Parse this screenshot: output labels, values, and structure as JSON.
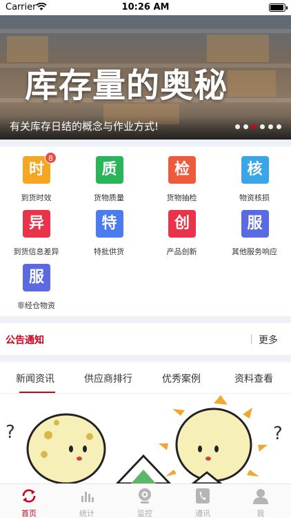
{
  "status_bar": {
    "carrier": "Carrier",
    "time": "10:26 AM"
  },
  "banner": {
    "headline": "库存量的奥秘",
    "caption": "有关库存日结的概念与作业方式!",
    "page_count": 6,
    "active_page": 3
  },
  "grid": [
    {
      "glyph": "时",
      "label": "到货时效",
      "color": "#f5a623",
      "badge": "8"
    },
    {
      "glyph": "质",
      "label": "货物质量",
      "color": "#2ab55a"
    },
    {
      "glyph": "检",
      "label": "货物抽检",
      "color": "#ee5a3c"
    },
    {
      "glyph": "核",
      "label": "物资核损",
      "color": "#3aa6e8"
    },
    {
      "glyph": "异",
      "label": "到货信息差异",
      "color": "#e8334a"
    },
    {
      "glyph": "特",
      "label": "特批供货",
      "color": "#4a7cf0"
    },
    {
      "glyph": "创",
      "label": "产品创新",
      "color": "#e8334a"
    },
    {
      "glyph": "服",
      "label": "其他服务响应",
      "color": "#5b6ae0"
    },
    {
      "glyph": "服",
      "label": "非经仓物资",
      "color": "#5b6ae0"
    }
  ],
  "notice": {
    "title": "公告通知",
    "more": "更多"
  },
  "tabs": [
    "新闻资讯",
    "供应商排行",
    "优秀案例",
    "资料查看"
  ],
  "active_tab": 0,
  "tabbar": [
    {
      "label": "首页",
      "icon": "refresh-icon",
      "active": true
    },
    {
      "label": "统计",
      "icon": "bar-chart-icon"
    },
    {
      "label": "监控",
      "icon": "camera-icon"
    },
    {
      "label": "通讯",
      "icon": "phone-icon"
    },
    {
      "label": "我",
      "icon": "user-icon"
    }
  ],
  "colors": {
    "accent": "#d0021b",
    "separator": "#eef1f5"
  }
}
